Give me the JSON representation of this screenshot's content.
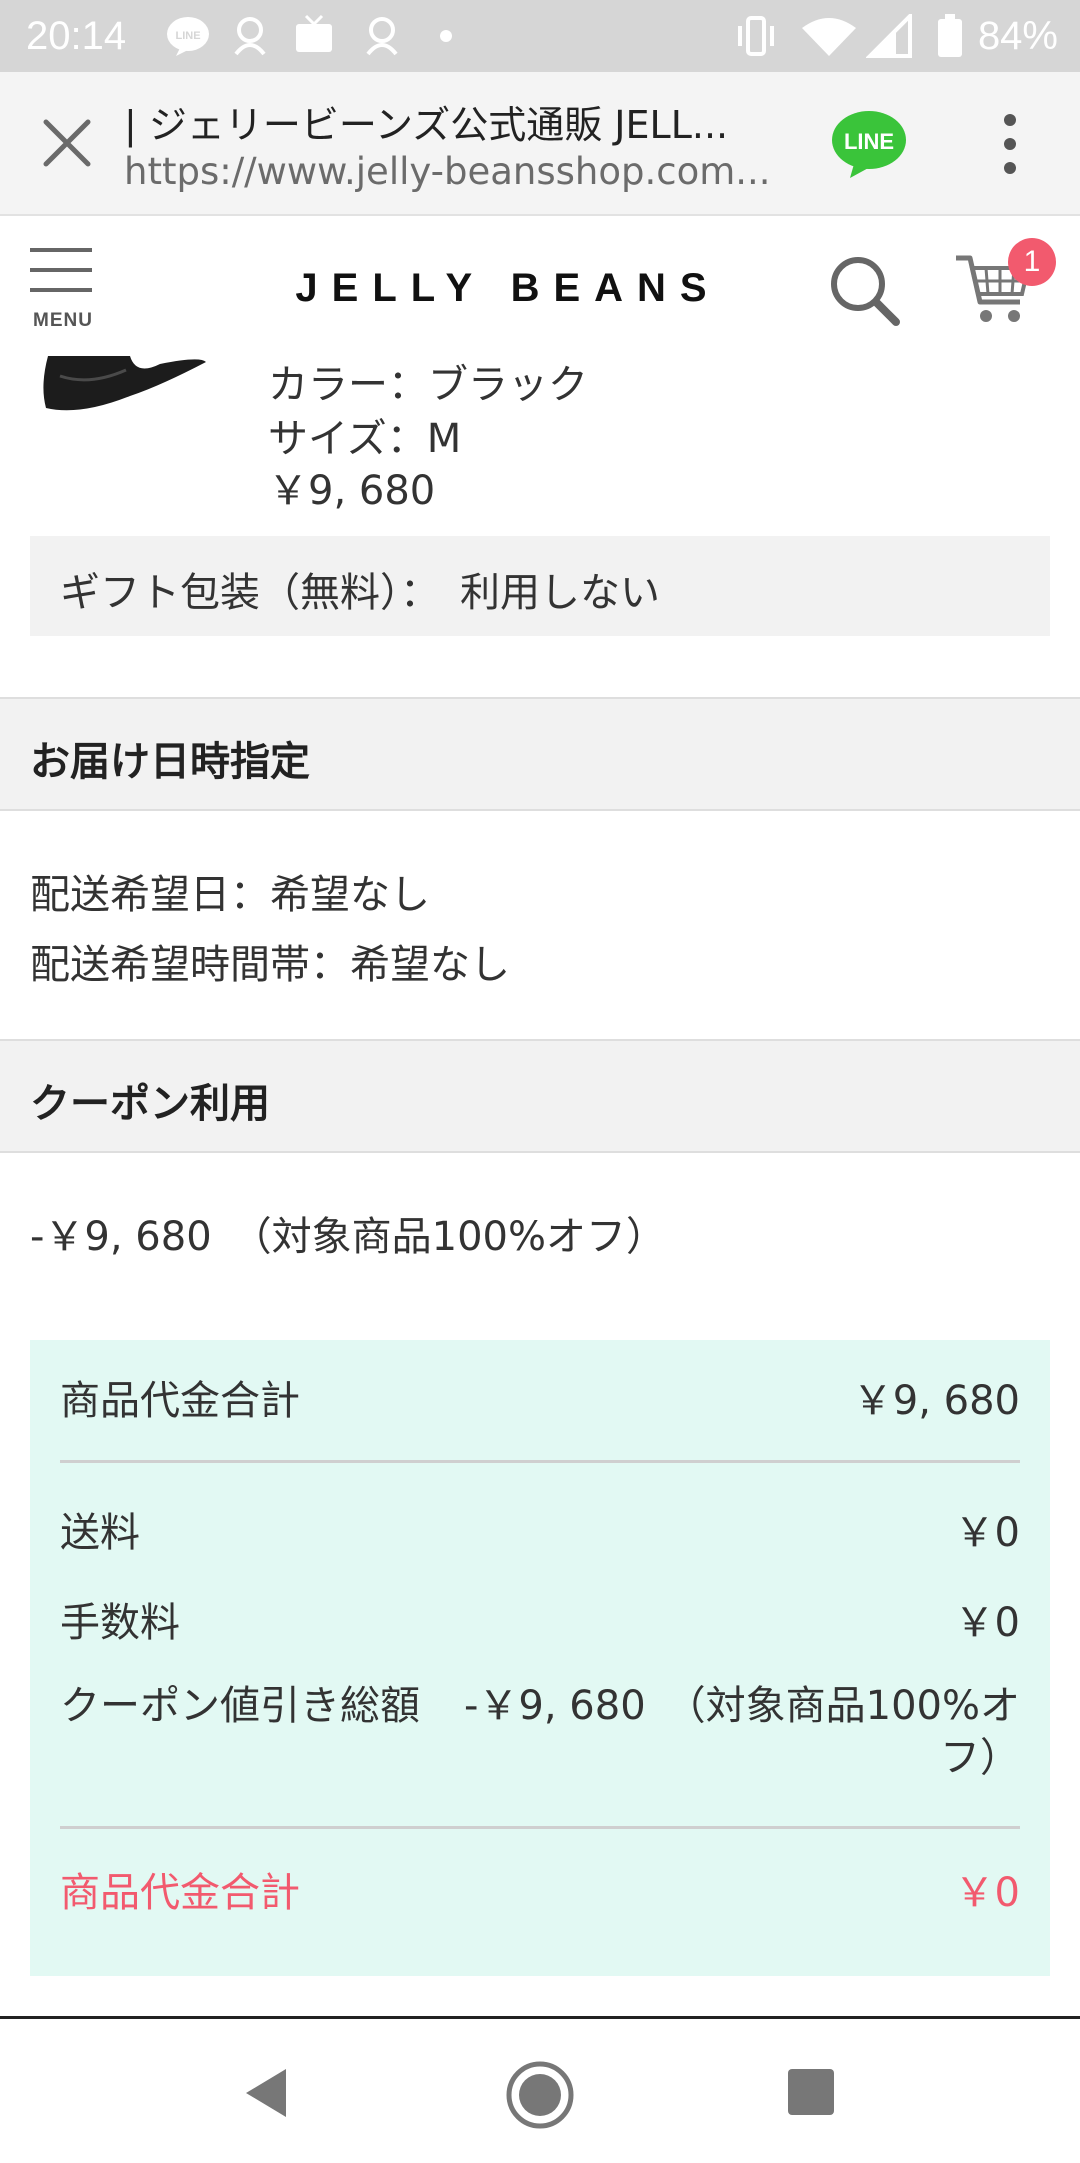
{
  "status_bar": {
    "time": "20:14",
    "battery": "84%",
    "notification_icons": [
      "line-icon",
      "notification-icon",
      "tv-icon",
      "notification-icon",
      "dot-icon"
    ],
    "system_icons": [
      "vibrate-icon",
      "wifi-icon",
      "signal-icon",
      "battery-icon"
    ]
  },
  "browser": {
    "title": "| ジェリービーンズ公式通販 JELL...",
    "url": "https://www.jelly-beansshop.com...",
    "line_label": "LINE"
  },
  "header": {
    "menu_label": "MENU",
    "logo": "JELLY BEANS",
    "cart_count": "1"
  },
  "product": {
    "color": "カラー：ブラック",
    "size": "サイズ：M",
    "price": "￥9, 680"
  },
  "gift": {
    "text": "ギフト包装（無料）：　利用しない"
  },
  "delivery": {
    "heading": "お届け日時指定",
    "date": "配送希望日：希望なし",
    "time": "配送希望時間帯：希望なし"
  },
  "coupon": {
    "heading": "クーポン利用",
    "discount": "-￥9, 680　（対象商品100%オフ）"
  },
  "summary": {
    "subtotal_label": "商品代金合計",
    "subtotal_value": "￥9, 680",
    "shipping_label": "送料",
    "shipping_value": "￥0",
    "fee_label": "手数料",
    "fee_value": "￥0",
    "coupon_label": "クーポン値引き総額",
    "coupon_value": "-￥9, 680　（対象商品100%オフ）",
    "total_label": "商品代金合計",
    "total_value": "￥0",
    "accent_color": "#f25a6e",
    "box_color": "#e2f9f3"
  },
  "nav": {
    "icons": [
      "back-icon",
      "home-icon",
      "recents-icon"
    ]
  }
}
